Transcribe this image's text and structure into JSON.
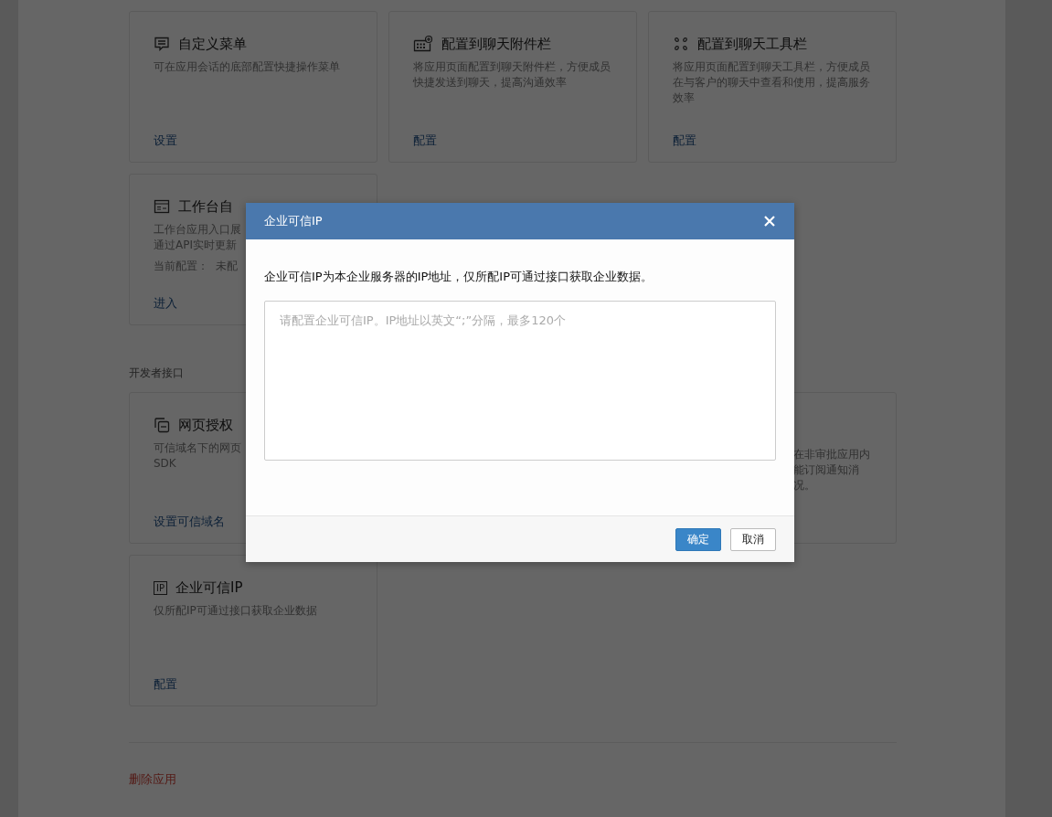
{
  "sections": [
    {
      "cards": [
        {
          "title": "自定义菜单",
          "description": [
            "可在应用会话的底部配置快捷操作菜单"
          ],
          "action": "设置"
        },
        {
          "title": "配置到聊天附件栏",
          "description": [
            "将应用页面配置到聊天附件栏，方便成员",
            "快捷发送到聊天，提高沟通效率"
          ],
          "action": "配置"
        },
        {
          "title": "配置到聊天工具栏",
          "description": [
            "将应用页面配置到聊天工具栏，方便成员",
            "在与客户的聊天中查看和使用，提高服务",
            "效率"
          ],
          "action": "配置"
        },
        {
          "title": "工作台自",
          "description": [
            "工作台应用入口展",
            "通过API实时更新"
          ],
          "config_label": "当前配置：",
          "config_value": "未配",
          "action": "进入"
        }
      ]
    },
    {
      "title": "开发者接口",
      "cards": [
        {
          "title": "网页授权",
          "description": [
            "可信域名下的网页",
            "SDK"
          ],
          "action": "设置可信域名"
        },
        {
          "kind": "partial",
          "description": [
            "在非审批应用内",
            "能订阅通知消",
            "况。"
          ]
        },
        {
          "icon_text": "IP",
          "title": "企业可信IP",
          "description": [
            "仅所配IP可通过接口获取企业数据"
          ],
          "action": "配置"
        }
      ]
    }
  ],
  "delete_link": "删除应用",
  "dialog": {
    "title": "企业可信IP",
    "intro": "企业可信IP为本企业服务器的IP地址，仅所配IP可通过接口获取企业数据。",
    "input": {
      "placeholder": "请配置企业可信IP。IP地址以英文“;”分隔，最多120个"
    },
    "buttons": [
      {
        "label": "确定",
        "kind": "primary"
      },
      {
        "label": "取消",
        "kind": "default"
      }
    ]
  }
}
